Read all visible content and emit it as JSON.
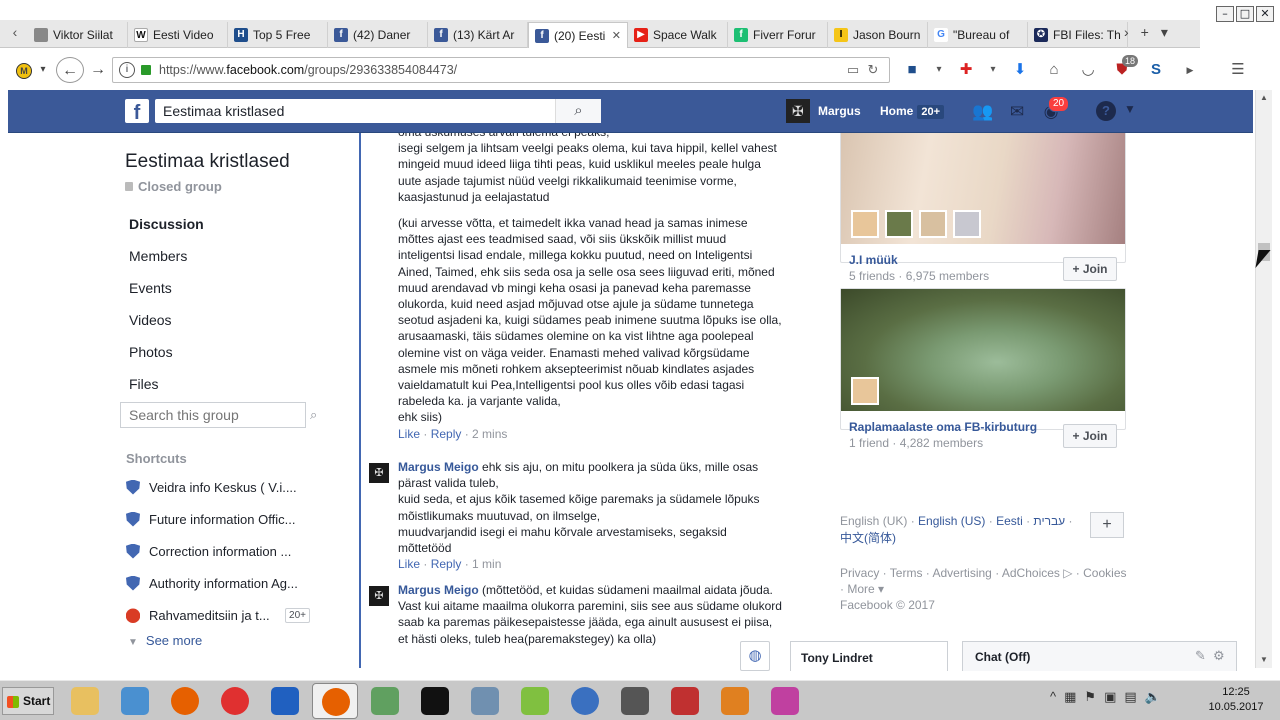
{
  "browser": {
    "window_controls": [
      "–",
      "□",
      "✕"
    ],
    "tabs": [
      {
        "label": "Viktor Siilat",
        "icon": "generic-page-icon",
        "color": "#888888",
        "active": false
      },
      {
        "label": "Eesti Video",
        "icon": "wikipedia-icon",
        "color": "#333333",
        "active": false
      },
      {
        "label": "Top 5 Free",
        "icon": "h-logo-icon",
        "color": "#1f4e8c",
        "active": false
      },
      {
        "label": "(42) Daner",
        "icon": "facebook-icon",
        "color": "#3b5998",
        "active": false
      },
      {
        "label": "(13) Kärt Ar",
        "icon": "facebook-icon",
        "color": "#3b5998",
        "active": false
      },
      {
        "label": "(20) Eesti",
        "icon": "facebook-icon",
        "color": "#3b5998",
        "active": true
      },
      {
        "label": "Space Walk",
        "icon": "youtube-icon",
        "color": "#e62117",
        "active": false
      },
      {
        "label": "Fiverr Forur",
        "icon": "fiverr-icon",
        "color": "#1dbf73",
        "active": false
      },
      {
        "label": "Jason Bourn",
        "icon": "imdb-icon",
        "color": "#f5c518",
        "active": false
      },
      {
        "label": "\"Bureau of",
        "icon": "google-icon",
        "color": "#4285f4",
        "active": false
      },
      {
        "label": "FBI Files: Th",
        "icon": "fbi-seal-icon",
        "color": "#1b2a5a",
        "active": false
      }
    ],
    "url_prefix": "https://www.",
    "url_domain": "facebook.com",
    "url_path": "/groups/293633854084473/",
    "toolbar_badge": "18"
  },
  "fb": {
    "search_value": "Eestimaa kristlased",
    "user_name": "Margus",
    "home_label": "Home",
    "home_badge": "20+",
    "notif_badge": "20",
    "help_label": "?"
  },
  "group": {
    "title": "Eestimaa kristlased",
    "privacy": "Closed group",
    "nav": [
      "Discussion",
      "Members",
      "Events",
      "Videos",
      "Photos",
      "Files"
    ],
    "active_nav": "Discussion",
    "search_placeholder": "Search this group",
    "shortcuts_heading": "Shortcuts",
    "shortcuts": [
      {
        "label": "Veidra info Keskus ( V.i....",
        "badge": ""
      },
      {
        "label": "Future information Offic...",
        "badge": ""
      },
      {
        "label": "Correction information ...",
        "badge": ""
      },
      {
        "label": "Authority information Ag...",
        "badge": ""
      },
      {
        "label": "Rahvameditsiin ja t...",
        "badge": "20+"
      }
    ],
    "see_more": "See more"
  },
  "comments": [
    {
      "author": "",
      "paragraphs": [
        "oma uskumuses arvan tulema ei peaks,\nisegi selgem ja lihtsam veelgi peaks olema, kui tava hippil, kellel vahest mingeid muud ideed liiga tihti peas, kuid usklikul meeles peale hulga uute asjade tajumist nüüd veelgi rikkalikumaid teenimise vorme, kaasjastunud ja eelajastatud",
        "(kui arvesse võtta, et taimedelt ikka vanad head ja samas inimese mõttes ajast ees teadmised saad, või siis ükskõik millist muud inteligentsi lisad endale, millega kokku puutud, need on Inteligentsi Ained, Taimed, ehk siis seda osa ja selle osa sees liiguvad eriti, mõned muud arendavad vb mingi keha osasi ja panevad keha paremasse olukorda, kuid need asjad mõjuvad otse ajule ja südame tunnetega seotud asjadeni ka, kuigi südames peab inimene suutma lõpuks ise olla, arusaamaski, täis südames olemine on ka vist lihtne aga poolepeal olemine vist on väga veider. Enamasti mehed valivad kõrgsüdame asmele mis mõneti rohkem aksepteerimist nõuab kindlates asjades vaieldamatult kui Pea,Intelligentsi pool kus olles võib edasi tagasi rabeleda ka. ja varjante valida,\nehk siis)"
      ],
      "like": "Like",
      "reply": "Reply",
      "time": "2 mins"
    },
    {
      "author": "Margus Meigo",
      "paragraphs": [
        "ehk sis aju, on mitu poolkera ja süda üks, mille osas pärast valida tuleb,\nkuid seda, et ajus kõik tasemed kõige paremaks ja südamele lõpuks mõistlikumaks muutuvad, on ilmselge,\nmuudvarjandid isegi ei mahu kõrvale arvestamiseks, segaksid mõttetööd"
      ],
      "like": "Like",
      "reply": "Reply",
      "time": "1 min"
    },
    {
      "author": "Margus Meigo",
      "paragraphs": [
        "(mõttetööd, et kuidas südameni maailmal aidata jõuda. Vast kui aitame maailma olukorra paremini, siis see aus südame olukord saab ka paremas päikesepaistesse jääda, ega ainult aususest ei piisa, et hästi oleks, tuleb hea(paremakstegey) ka olla)"
      ],
      "like": "",
      "reply": "",
      "time": ""
    }
  ],
  "suggested_groups": [
    {
      "name": "J.I müük",
      "meta": "5 friends · 6,975 members",
      "join": "+ Join"
    },
    {
      "name": "Raplamaalaste oma FB-kirbuturg",
      "meta": "1 friend · 4,282 members",
      "join": "+ Join"
    }
  ],
  "languages": {
    "current": "English (UK)",
    "others": [
      "English (US)",
      "Eesti",
      "עברית",
      "中文(简体)"
    ],
    "add": "+"
  },
  "footer": {
    "links": [
      "Privacy",
      "Terms",
      "Advertising",
      "AdChoices",
      "Cookies",
      "More ▾"
    ],
    "copyright": "Facebook © 2017"
  },
  "chat": {
    "tab_name": "Tony Lindret",
    "sidebar_label": "Chat (Off)"
  },
  "taskbar": {
    "start_label": "Start",
    "time": "12:25",
    "date": "10.05.2017"
  }
}
